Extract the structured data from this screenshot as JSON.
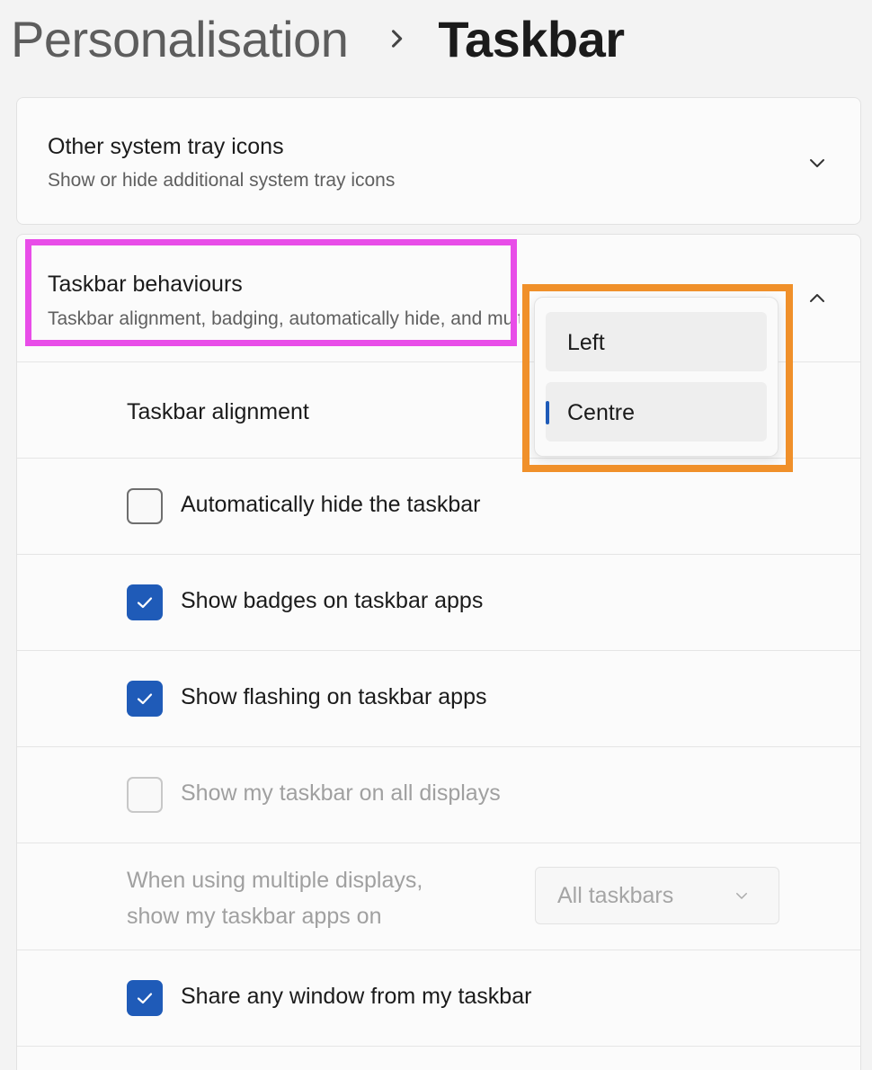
{
  "breadcrumb": {
    "parent": "Personalisation",
    "current": "Taskbar"
  },
  "system_tray": {
    "title": "Other system tray icons",
    "subtitle": "Show or hide additional system tray icons",
    "icon": "chevron-down-icon"
  },
  "behaviours": {
    "title": "Taskbar behaviours",
    "subtitle": "Taskbar alignment, badging, automatically hide, and multiple displays",
    "icon": "chevron-up-icon",
    "alignment": {
      "label": "Taskbar alignment",
      "options": [
        "Left",
        "Centre"
      ],
      "selected": "Centre"
    },
    "auto_hide": {
      "label": "Automatically hide the taskbar",
      "checked": false
    },
    "badges": {
      "label": "Show badges on taskbar apps",
      "checked": true
    },
    "flashing": {
      "label": "Show flashing on taskbar apps",
      "checked": true
    },
    "all_displays": {
      "label": "Show my taskbar on all displays",
      "checked": false,
      "disabled": true
    },
    "multi_display": {
      "label_line1": "When using multiple displays,",
      "label_line2": "show my taskbar apps on",
      "value": "All taskbars",
      "disabled": true
    },
    "share_window": {
      "label": "Share any window from my taskbar",
      "checked": true
    }
  },
  "colors": {
    "accent": "#1f5bb8",
    "highlight_magenta": "#e84de8",
    "highlight_orange": "#f0902a"
  }
}
